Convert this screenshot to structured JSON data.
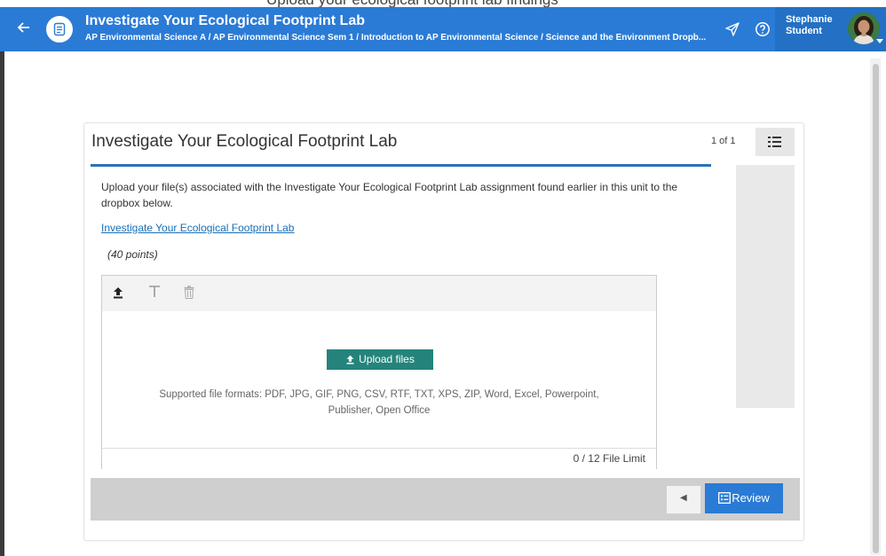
{
  "top_strip": {
    "text": "Upload your ecological footprint lab findings"
  },
  "header": {
    "title": "Investigate Your Ecological Footprint Lab",
    "breadcrumb": "AP Environmental Science A / AP Environmental Science Sem 1 / Introduction to AP Environmental Science / Science and the Environment Dropb...",
    "user_first": "Stephanie",
    "user_last": "Student",
    "icons": {
      "back": "arrow-left-icon",
      "app": "assignment-icon",
      "send": "send-icon",
      "help": "help-icon"
    },
    "colors": {
      "bar": "#2a7bd6",
      "user_box": "#2470c4"
    }
  },
  "card": {
    "title": "Investigate Your Ecological Footprint Lab",
    "pager": "1 of 1",
    "description": "Upload your file(s) associated with the Investigate Your Ecological Footprint Lab assignment found earlier in this unit to the dropbox below.",
    "link_text": "Investigate Your Ecological Footprint Lab",
    "points": "(40 points)"
  },
  "dropbox": {
    "upload_label": "Upload files",
    "formats": "Supported file formats: PDF, JPG, GIF, PNG, CSV, RTF, TXT, XPS, ZIP, Word, Excel, Powerpoint, Publisher, Open Office",
    "file_limit": "0 / 12 File Limit",
    "toolbar": [
      "upload-icon",
      "text-icon",
      "trash-icon"
    ],
    "button_color": "#24847b"
  },
  "footer": {
    "review_label": "Review",
    "prev_icon": "caret-left-icon"
  }
}
